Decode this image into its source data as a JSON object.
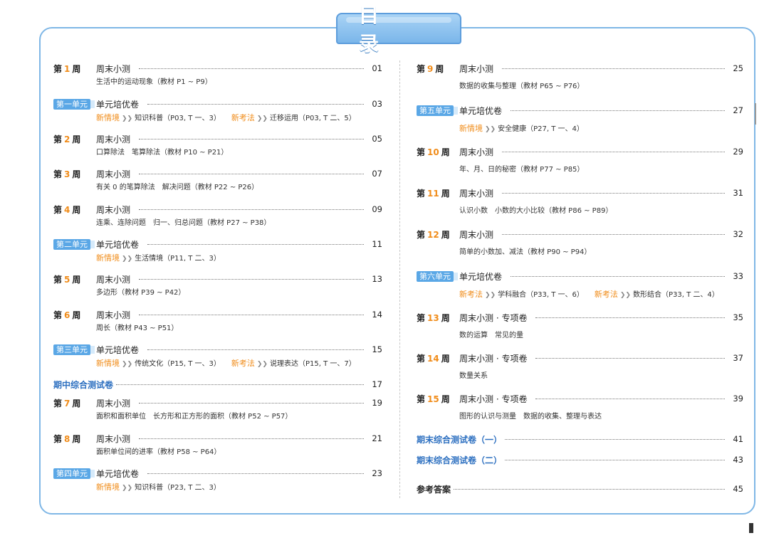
{
  "header": {
    "title": "目 录"
  },
  "left": [
    {
      "kind": "week",
      "num": "1",
      "title": "周末小测",
      "page": "01",
      "sub": [
        {
          "text": "生活中的运动现象（教材 P1 ~ P9）"
        }
      ]
    },
    {
      "kind": "unit",
      "badge": "第一单元",
      "title": "单元培优卷",
      "page": "03",
      "sub": [
        {
          "tag": "新情境",
          "text": "知识科普（P03, T 一、3）"
        },
        {
          "tag": "新考法",
          "text": "迁移运用（P03, T 二、5）"
        }
      ]
    },
    {
      "kind": "week",
      "num": "2",
      "title": "周末小测",
      "page": "05",
      "sub": [
        {
          "text": "口算除法　笔算除法（教材 P10 ~ P21）"
        }
      ]
    },
    {
      "kind": "week",
      "num": "3",
      "title": "周末小测",
      "page": "07",
      "sub": [
        {
          "text": "有关 0 的笔算除法　解决问题（教材 P22 ~ P26）"
        }
      ]
    },
    {
      "kind": "week",
      "num": "4",
      "title": "周末小测",
      "page": "09",
      "sub": [
        {
          "text": "连乘、连除问题　归一、归总问题（教材 P27 ~ P38）"
        }
      ]
    },
    {
      "kind": "unit",
      "badge": "第二单元",
      "title": "单元培优卷",
      "page": "11",
      "sub": [
        {
          "tag": "新情境",
          "text": "生活情境（P11, T 二、3）"
        }
      ]
    },
    {
      "kind": "week",
      "num": "5",
      "title": "周末小测",
      "page": "13",
      "sub": [
        {
          "text": "多边形（教材 P39 ~ P42）"
        }
      ]
    },
    {
      "kind": "week",
      "num": "6",
      "title": "周末小测",
      "page": "14",
      "sub": [
        {
          "text": "周长（教材 P43 ~ P51）"
        }
      ]
    },
    {
      "kind": "unit",
      "badge": "第三单元",
      "title": "单元培优卷",
      "page": "15",
      "sub": [
        {
          "tag": "新情境",
          "text": "传统文化（P15, T 一、3）"
        },
        {
          "tag": "新考法",
          "text": "说理表达（P15, T 一、7）"
        }
      ]
    },
    {
      "kind": "special",
      "title": "期中综合测试卷",
      "page": "17",
      "sub": []
    },
    {
      "kind": "week",
      "num": "7",
      "title": "周末小测",
      "page": "19",
      "sub": [
        {
          "text": "面积和面积单位　长方形和正方形的面积（教材 P52 ~ P57）"
        }
      ]
    },
    {
      "kind": "week",
      "num": "8",
      "title": "周末小测",
      "page": "21",
      "sub": [
        {
          "text": "面积单位间的进率（教材 P58 ~ P64）"
        }
      ]
    },
    {
      "kind": "unit",
      "badge": "第四单元",
      "title": "单元培优卷",
      "page": "23",
      "sub": [
        {
          "tag": "新情境",
          "text": "知识科普（P23, T 二、3）"
        }
      ]
    }
  ],
  "right": [
    {
      "kind": "week",
      "num": "9",
      "title": "周末小测",
      "page": "25",
      "sub": [
        {
          "text": "数据的收集与整理（教材 P65 ~ P76）"
        }
      ]
    },
    {
      "kind": "unit",
      "badge": "第五单元",
      "title": "单元培优卷",
      "page": "27",
      "sub": [
        {
          "tag": "新情境",
          "text": "安全健康（P27, T 一、4）"
        }
      ]
    },
    {
      "kind": "week",
      "num": "10",
      "title": "周末小测",
      "page": "29",
      "sub": [
        {
          "text": "年、月、日的秘密（教材 P77 ~ P85）"
        }
      ]
    },
    {
      "kind": "week",
      "num": "11",
      "title": "周末小测",
      "page": "31",
      "sub": [
        {
          "text": "认识小数　小数的大小比较（教材 P86 ~ P89）"
        }
      ]
    },
    {
      "kind": "week",
      "num": "12",
      "title": "周末小测",
      "page": "32",
      "sub": [
        {
          "text": "简单的小数加、减法（教材 P90 ~ P94）"
        }
      ]
    },
    {
      "kind": "unit",
      "badge": "第六单元",
      "title": "单元培优卷",
      "page": "33",
      "sub": [
        {
          "tag": "新考法",
          "text": "学科融合（P33, T 一、6）"
        },
        {
          "tag": "新考法",
          "text": "数形结合（P33, T 二、4）"
        }
      ]
    },
    {
      "kind": "week",
      "num": "13",
      "title": "周末小测 · 专项卷",
      "page": "35",
      "sub": [
        {
          "text": "数的运算　常见的量"
        }
      ]
    },
    {
      "kind": "week",
      "num": "14",
      "title": "周末小测 · 专项卷",
      "page": "37",
      "sub": [
        {
          "text": "数量关系"
        }
      ]
    },
    {
      "kind": "week",
      "num": "15",
      "title": "周末小测 · 专项卷",
      "page": "39",
      "sub": [
        {
          "text": "图形的认识与测量　数据的收集、整理与表达"
        }
      ]
    },
    {
      "kind": "special",
      "title": "期末综合测试卷（一）",
      "page": "41",
      "sub": []
    },
    {
      "kind": "special",
      "title": "期末综合测试卷（二）",
      "page": "43",
      "sub": []
    },
    {
      "kind": "plain",
      "title": "参考答案",
      "page": "45",
      "sub": []
    }
  ],
  "labels": {
    "week_prefix": "第",
    "week_suffix": "周"
  }
}
